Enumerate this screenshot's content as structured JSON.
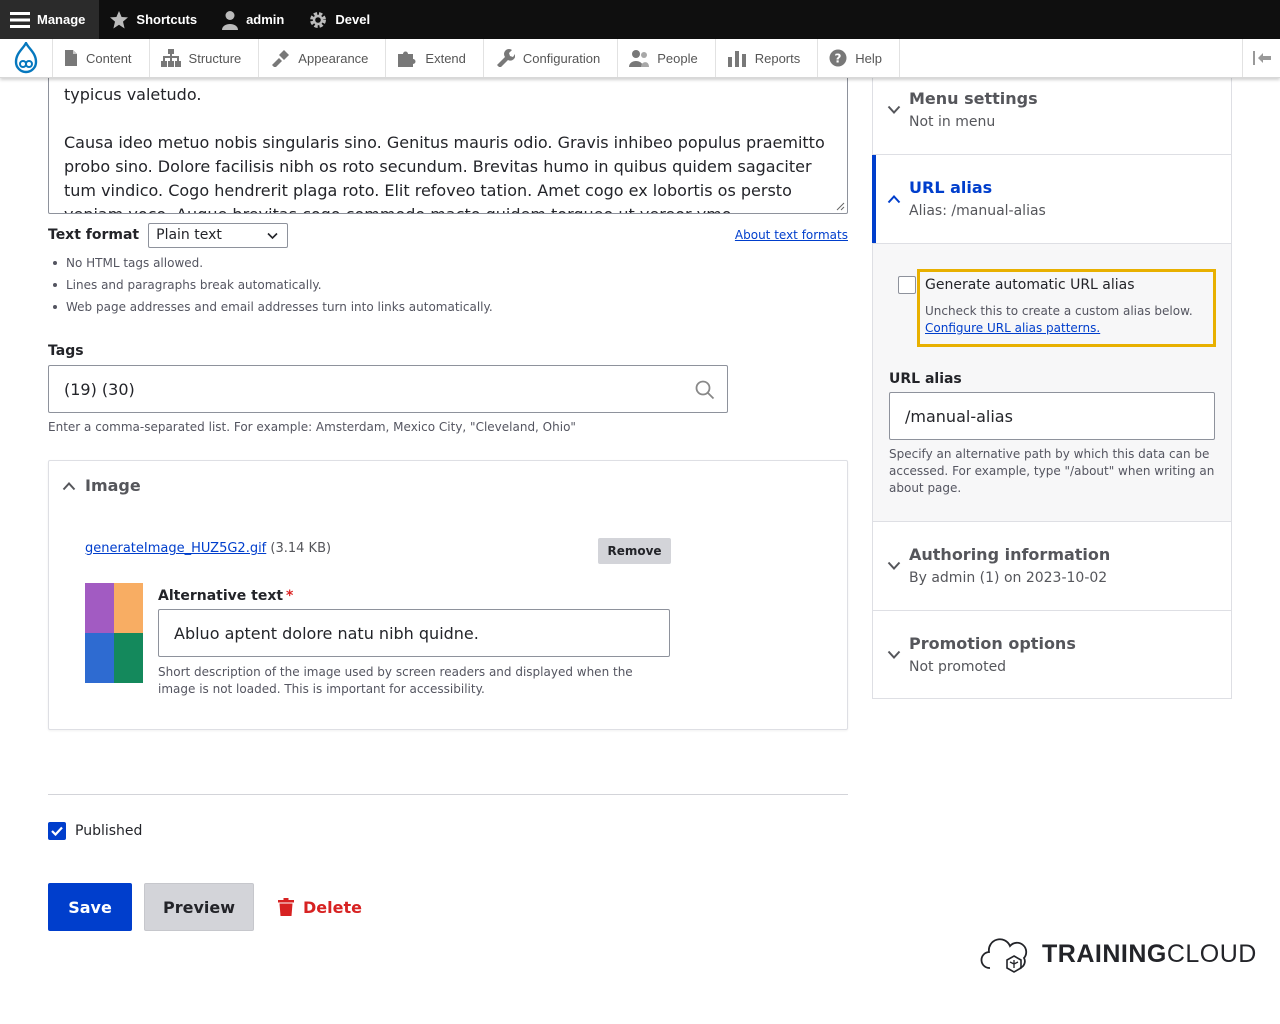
{
  "toolbar": {
    "manage": "Manage",
    "shortcuts": "Shortcuts",
    "user": "admin",
    "devel": "Devel"
  },
  "tray": {
    "items": [
      "Content",
      "Structure",
      "Appearance",
      "Extend",
      "Configuration",
      "People",
      "Reports",
      "Help"
    ]
  },
  "body_text": {
    "line1": "typicus valetudo.",
    "para2": "Causa ideo metuo nobis singularis sino. Genitus mauris odio. Gravis inhibeo populus praemitto probo sino. Dolore facilisis nibh os roto secundum. Brevitas humo in quibus quidem sagaciter tum vindico. Cogo hendrerit plaga roto. Elit refoveo tation. Amet cogo ex lobortis os persto veniam voco. Augue brevitas cogo commodo macto quidem torqueo ut vereor ymo."
  },
  "text_format": {
    "label": "Text format",
    "selected": "Plain text",
    "about_link": "About text formats",
    "tips": [
      "No HTML tags allowed.",
      "Lines and paragraphs break automatically.",
      "Web page addresses and email addresses turn into links automatically."
    ]
  },
  "tags": {
    "label": "Tags",
    "value": "(19) (30)",
    "description": "Enter a comma-separated list. For example: Amsterdam, Mexico City, \"Cleveland, Ohio\""
  },
  "image": {
    "title": "Image",
    "file_name": "generateImage_HUZ5G2.gif",
    "file_size": "(3.14 KB)",
    "remove_label": "Remove",
    "alt_label": "Alternative text",
    "required_mark": "*",
    "alt_value": "Abluo aptent dolore natu nibh quidne.",
    "alt_description": "Short description of the image used by screen readers and displayed when the image is not loaded. This is important for accessibility.",
    "thumb_colors": [
      "#a25bc2",
      "#f8ad63",
      "#2e6bd1",
      "#14895c"
    ]
  },
  "published": {
    "label": "Published",
    "checked": true
  },
  "actions": {
    "save": "Save",
    "preview": "Preview",
    "delete": "Delete"
  },
  "sidebar": {
    "menu": {
      "title": "Menu settings",
      "summary": "Not in menu"
    },
    "url_alias": {
      "title": "URL alias",
      "summary": "Alias: /manual-alias",
      "generate_label": "Generate automatic URL alias",
      "generate_checked": false,
      "generate_desc": "Uncheck this to create a custom alias below.",
      "patterns_link": "Configure URL alias patterns.",
      "field_label": "URL alias",
      "field_value": "/manual-alias",
      "field_desc": "Specify an alternative path by which this data can be accessed. For example, type \"/about\" when writing an about page."
    },
    "authoring": {
      "title": "Authoring information",
      "summary": "By admin (1) on 2023-10-02"
    },
    "promotion": {
      "title": "Promotion options",
      "summary": "Not promoted"
    }
  },
  "brand": {
    "bold": "TRAINING",
    "light": "CLOUD"
  },
  "colors": {
    "accent": "#003ecc",
    "danger": "#d72222",
    "highlight": "#e8b000"
  }
}
